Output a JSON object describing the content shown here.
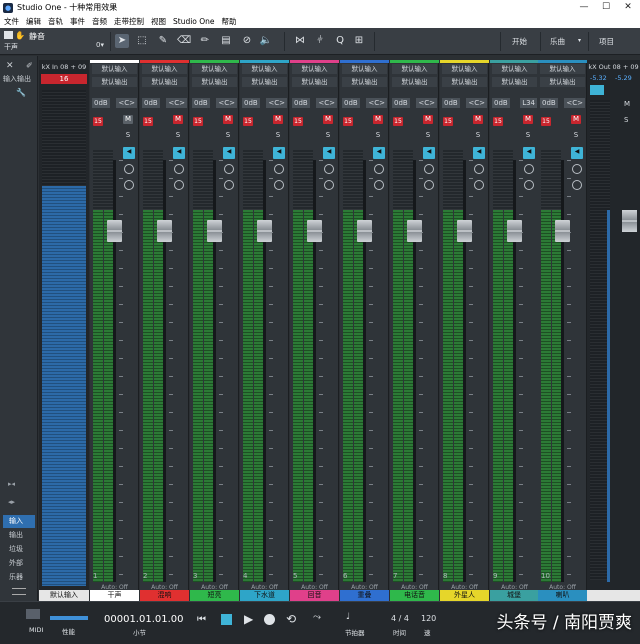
{
  "window": {
    "title": "Studio One - 十种常用效果",
    "minimize": "—",
    "maximize": "☐",
    "close": "✕"
  },
  "menu": [
    "文件",
    "编辑",
    "音轨",
    "事件",
    "音频",
    "走带控制",
    "视图",
    "Studio One",
    "帮助"
  ],
  "toolbar": {
    "track_name": "静音",
    "track_sub": "干声",
    "start_label": "开始",
    "song_label": "乐曲",
    "project_label": "项目"
  },
  "left_panel": {
    "input_label": "输入输出",
    "items": [
      "输入",
      "输出",
      "垃圾",
      "外部",
      "乐器"
    ],
    "selected": "输入"
  },
  "input_channel": {
    "title": "kX In 08 + 09",
    "value": "16",
    "name": "默认输入"
  },
  "output_channel": {
    "title": "kX Out 08 + 09",
    "left_db": "-5.32",
    "right_db": "-5.29"
  },
  "channels": [
    {
      "num": "1",
      "input": "默认输入",
      "output": "默认输出",
      "gain": "0dB",
      "pan": "<C>",
      "name": "干声",
      "color": "#ffffff",
      "mute_red": false
    },
    {
      "num": "2",
      "input": "默认输入",
      "output": "默认输出",
      "gain": "0dB",
      "pan": "<C>",
      "name": "混响",
      "color": "#e03030",
      "mute_red": true
    },
    {
      "num": "3",
      "input": "默认输入",
      "output": "默认输出",
      "gain": "0dB",
      "pan": "<C>",
      "name": "短亮",
      "color": "#2fb84b",
      "mute_red": true
    },
    {
      "num": "4",
      "input": "默认输入",
      "output": "默认输出",
      "gain": "0dB",
      "pan": "<C>",
      "name": "下水道",
      "color": "#2ea5c8",
      "mute_red": true
    },
    {
      "num": "5",
      "input": "默认输入",
      "output": "默认输出",
      "gain": "0dB",
      "pan": "<C>",
      "name": "回音",
      "color": "#e0408a",
      "mute_red": true
    },
    {
      "num": "6",
      "input": "默认输入",
      "output": "默认输出",
      "gain": "0dB",
      "pan": "<C>",
      "name": "重叠",
      "color": "#2f6fd0",
      "mute_red": true
    },
    {
      "num": "7",
      "input": "默认输入",
      "output": "默认输出",
      "gain": "0dB",
      "pan": "<C>",
      "name": "电话音",
      "color": "#2fb84b",
      "mute_red": true
    },
    {
      "num": "8",
      "input": "默认输入",
      "output": "默认输出",
      "gain": "0dB",
      "pan": "<C>",
      "name": "外星人",
      "color": "#e6d62a",
      "mute_red": true
    },
    {
      "num": "9",
      "input": "默认输入",
      "output": "默认输出",
      "gain": "0dB",
      "pan": "L34",
      "name": "城堡",
      "color": "#3aa0a0",
      "mute_red": true
    },
    {
      "num": "10",
      "input": "默认输入",
      "output": "默认输出",
      "gain": "0dB",
      "pan": "<C>",
      "name": "喇叭",
      "color": "#2a8fbf",
      "mute_red": true
    }
  ],
  "auto_label": "Auto: Off",
  "transport": {
    "midi": "MIDI",
    "perf": "性能",
    "time": "00001.01.01.00",
    "time_sub": "小节",
    "sig": "4 / 4",
    "sig_sub": "时间",
    "tempo": "120",
    "tempo_sub": "速",
    "metronome_sub": "节拍器"
  },
  "watermark": "头条号 / 南阳贾爽"
}
